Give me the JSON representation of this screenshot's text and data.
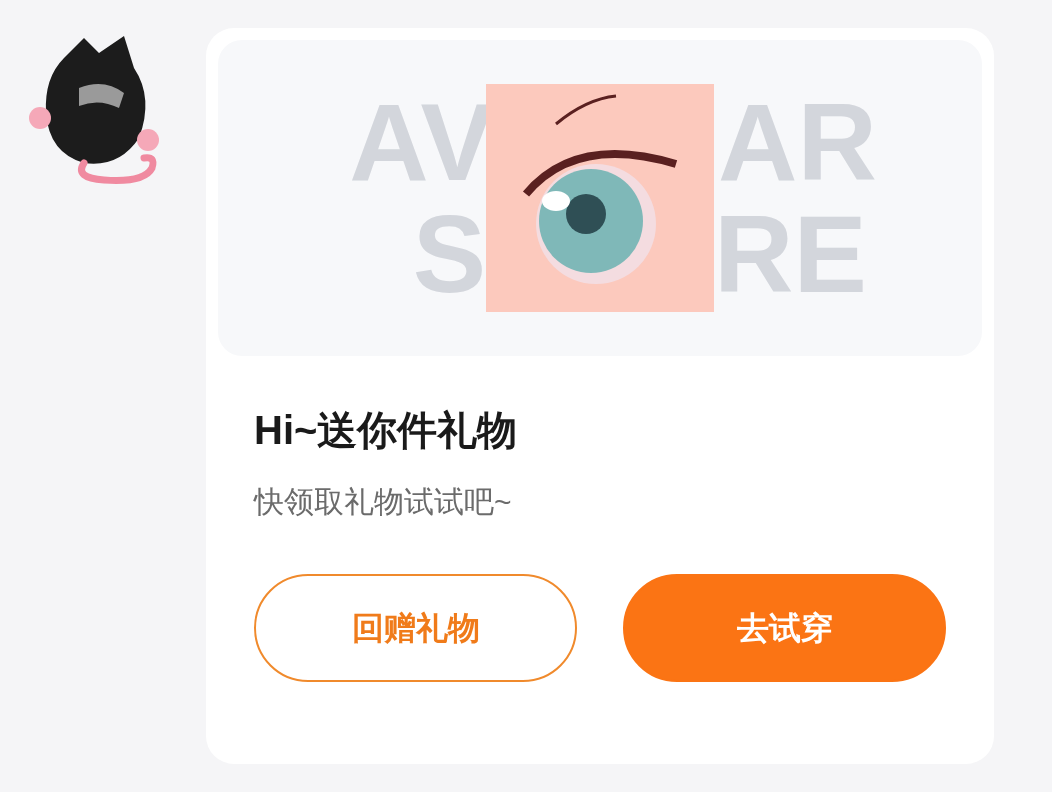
{
  "preview": {
    "backdrop_text": [
      {
        "left": "AV",
        "right": "AR"
      },
      {
        "left": "S",
        "right": "RE"
      }
    ]
  },
  "message": {
    "title": "Hi~送你件礼物",
    "subtitle": "快领取礼物试试吧~"
  },
  "buttons": [
    {
      "label": "回赠礼物",
      "kind": "outline"
    },
    {
      "label": "去试穿",
      "kind": "filled"
    }
  ]
}
